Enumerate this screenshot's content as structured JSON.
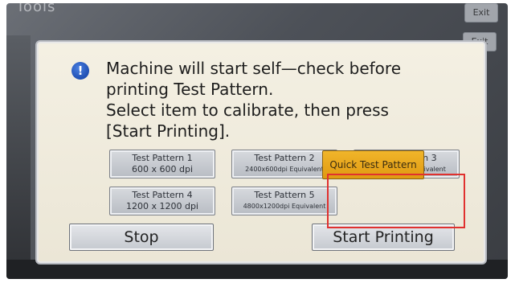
{
  "background": {
    "title": "Tools",
    "exit_label": "Exit"
  },
  "dialog": {
    "message_lines": [
      "Machine will start self—check before",
      "printing Test Pattern.",
      "Select item to calibrate, then press",
      "[Start Printing]."
    ],
    "patterns": [
      {
        "line1": "Test Pattern 1",
        "line2": "600 x 600 dpi"
      },
      {
        "line1": "Test Pattern 2",
        "line2": "2400x600dpi Equivalent"
      },
      {
        "line1": "Test Pattern 3",
        "line2": "9600x600dpi Equivalent"
      },
      {
        "line1": "Test Pattern 4",
        "line2": "1200 x 1200 dpi"
      },
      {
        "line1": "Test Pattern 5",
        "line2": "4800x1200dpi Equivalent"
      }
    ],
    "quick_label": "Quick Test Pattern",
    "stop_label": "Stop",
    "start_label": "Start Printing"
  },
  "colors": {
    "quick_button": "#e9a51c",
    "highlight_box": "#e0312f",
    "info_icon": "#1f4fb3"
  },
  "icons": {
    "info": "info-icon"
  }
}
